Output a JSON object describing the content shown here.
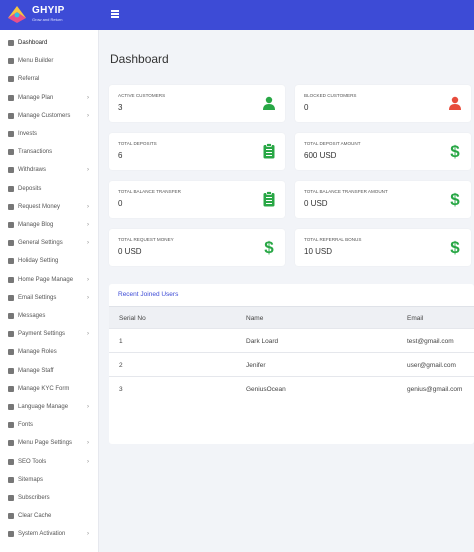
{
  "brand": {
    "name": "GHYIP",
    "tagline": "Grow and Return"
  },
  "sidebar": {
    "items": [
      {
        "label": "Dashboard",
        "chevron": false
      },
      {
        "label": "Menu Builder",
        "chevron": false
      },
      {
        "label": "Referral",
        "chevron": false
      },
      {
        "label": "Manage Plan",
        "chevron": true
      },
      {
        "label": "Manage Customers",
        "chevron": true
      },
      {
        "label": "Invests",
        "chevron": false
      },
      {
        "label": "Transactions",
        "chevron": false
      },
      {
        "label": "Withdraws",
        "chevron": true
      },
      {
        "label": "Deposits",
        "chevron": false
      },
      {
        "label": "Request Money",
        "chevron": true
      },
      {
        "label": "Manage Blog",
        "chevron": true
      },
      {
        "label": "General Settings",
        "chevron": true
      },
      {
        "label": "Holiday Setting",
        "chevron": false
      },
      {
        "label": "Home Page Manage",
        "chevron": true
      },
      {
        "label": "Email Settings",
        "chevron": true
      },
      {
        "label": "Messages",
        "chevron": false
      },
      {
        "label": "Payment Settings",
        "chevron": true
      },
      {
        "label": "Manage Roles",
        "chevron": false
      },
      {
        "label": "Manage Staff",
        "chevron": false
      },
      {
        "label": "Manage KYC Form",
        "chevron": false
      },
      {
        "label": "Language Manage",
        "chevron": true
      },
      {
        "label": "Fonts",
        "chevron": false
      },
      {
        "label": "Menu Page Settings",
        "chevron": true
      },
      {
        "label": "SEO Tools",
        "chevron": true
      },
      {
        "label": "Sitemaps",
        "chevron": false
      },
      {
        "label": "Subscribers",
        "chevron": false
      },
      {
        "label": "Clear Cache",
        "chevron": false
      },
      {
        "label": "System Activation",
        "chevron": true
      }
    ]
  },
  "main": {
    "title": "Dashboard",
    "cards": [
      {
        "label": "Active Customers",
        "value": "3",
        "icon": "user-icon",
        "color": "#28a745"
      },
      {
        "label": "Blocked Customers",
        "value": "0",
        "icon": "user-icon",
        "color": "#e74c3c"
      },
      {
        "label": "Total Deposits",
        "value": "6",
        "icon": "clipboard-icon",
        "color": "#28a745"
      },
      {
        "label": "Total Deposit Amount",
        "value": "600 USD",
        "icon": "dollar-icon",
        "color": "#28a745"
      },
      {
        "label": "Total Balance Transfer",
        "value": "0",
        "icon": "clipboard-icon",
        "color": "#28a745"
      },
      {
        "label": "Total Balance Transfer Amount",
        "value": "0 USD",
        "icon": "dollar-icon",
        "color": "#28a745"
      },
      {
        "label": "Total Request Money",
        "value": "0 USD",
        "icon": "dollar-icon",
        "color": "#28a745"
      },
      {
        "label": "Total Referral Bonus",
        "value": "10 USD",
        "icon": "dollar-icon",
        "color": "#28a745"
      }
    ],
    "recent": {
      "title": "Recent Joined Users",
      "columns": [
        "Serial No",
        "Name",
        "Email"
      ],
      "rows": [
        [
          "1",
          "Dark Loard",
          "test@gmail.com"
        ],
        [
          "2",
          "Jenifer",
          "user@gmail.com"
        ],
        [
          "3",
          "GeniusOcean",
          "genius@gmail.com"
        ]
      ]
    }
  },
  "colors": {
    "accent": "#3d4bd6",
    "success": "#28a745",
    "danger": "#e74c3c"
  }
}
